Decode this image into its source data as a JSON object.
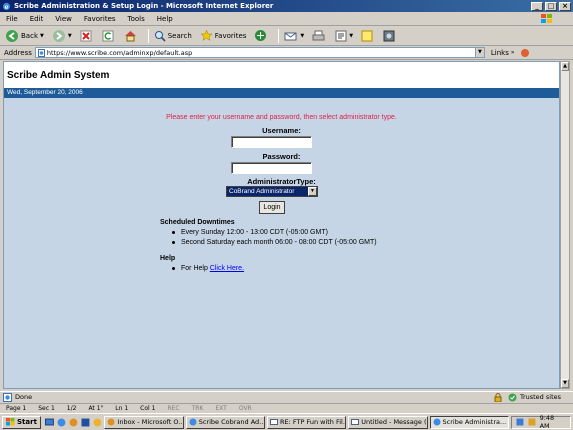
{
  "window": {
    "title": "Scribe Administration & Setup Login - Microsoft Internet Explorer",
    "buttons": [
      "_",
      "□",
      "×"
    ]
  },
  "menu": [
    "File",
    "Edit",
    "View",
    "Favorites",
    "Tools",
    "Help"
  ],
  "toolbar": {
    "back_label": "Back",
    "search_label": "Search",
    "favorites_label": "Favorites"
  },
  "address": {
    "label": "Address",
    "url": "https://www.scribe.com/adminxp/default.asp",
    "links_label": "Links"
  },
  "page": {
    "site_title": "Scribe Admin System",
    "date": "Wed, September 20, 2006",
    "prompt": "Please enter your username and password, then select administrator type.",
    "username_label": "Username:",
    "password_label": "Password:",
    "admin_type_label": "AdministratorType:",
    "admin_type_value": "CoBrand Administrator",
    "login_button": "Login",
    "downtimes_heading": "Scheduled Downtimes",
    "downtimes": [
      "Every Sunday 12:00 - 13:00 CDT (-05:00 GMT)",
      "Second Saturday each month 06:00 - 08:00 CDT (-05:00 GMT)"
    ],
    "help_heading": "Help",
    "help_text": "For Help",
    "help_link": "Click Here."
  },
  "status": {
    "left": "Done",
    "zone": "Trusted sites"
  },
  "word_status": {
    "page": "Page  1",
    "sec": "Sec  1",
    "of": "1/2",
    "at": "At  1\"",
    "ln": "Ln  1",
    "col": "Col  1",
    "rec": "REC",
    "trk": "TRK",
    "ext": "EXT",
    "ovr": "OVR"
  },
  "taskbar": {
    "start": "Start",
    "tasks": [
      "Inbox - Microsoft O...",
      "Scribe Cobrand Ad...",
      "RE: FTP Fun with Fil...",
      "Untitled - Message (...",
      "Scribe Administra..."
    ],
    "clock": "9:48 AM"
  }
}
